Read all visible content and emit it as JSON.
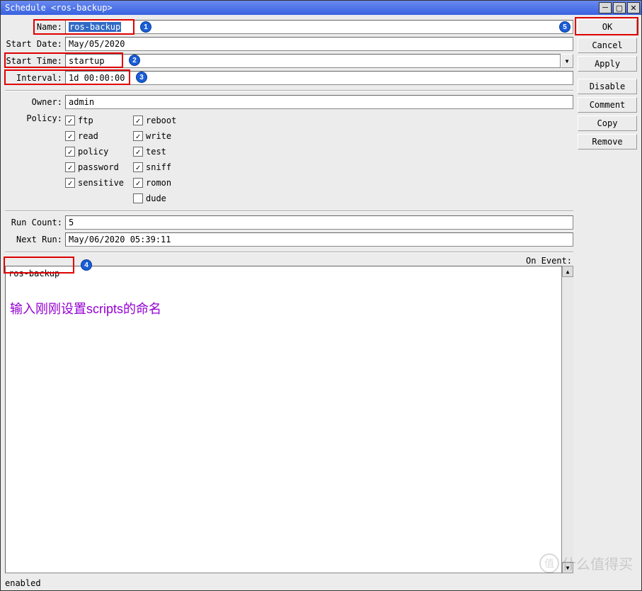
{
  "window": {
    "title": "Schedule <ros-backup>"
  },
  "form": {
    "name_label": "Name:",
    "name_value": "ros-backup",
    "start_date_label": "Start Date:",
    "start_date_value": "May/05/2020",
    "start_time_label": "Start Time:",
    "start_time_value": "startup",
    "interval_label": "Interval:",
    "interval_value": "1d 00:00:00",
    "owner_label": "Owner:",
    "owner_value": "admin",
    "policy_label": "Policy:",
    "policies": {
      "ftp": {
        "label": "ftp",
        "checked": true
      },
      "read": {
        "label": "read",
        "checked": true
      },
      "policy": {
        "label": "policy",
        "checked": true
      },
      "password": {
        "label": "password",
        "checked": true
      },
      "sensitive": {
        "label": "sensitive",
        "checked": true
      },
      "reboot": {
        "label": "reboot",
        "checked": true
      },
      "write": {
        "label": "write",
        "checked": true
      },
      "test": {
        "label": "test",
        "checked": true
      },
      "sniff": {
        "label": "sniff",
        "checked": true
      },
      "romon": {
        "label": "romon",
        "checked": true
      },
      "dude": {
        "label": "dude",
        "checked": false
      }
    },
    "run_count_label": "Run Count:",
    "run_count_value": "5",
    "next_run_label": "Next Run:",
    "next_run_value": "May/06/2020 05:39:11",
    "on_event_label": "On Event:",
    "on_event_value": "ros-backup"
  },
  "buttons": {
    "ok": "OK",
    "cancel": "Cancel",
    "apply": "Apply",
    "disable": "Disable",
    "comment": "Comment",
    "copy": "Copy",
    "remove": "Remove"
  },
  "status": "enabled",
  "annotations": {
    "text": "输入刚刚设置scripts的命名",
    "n1": "1",
    "n2": "2",
    "n3": "3",
    "n4": "4",
    "n5": "5"
  },
  "watermark": "什么值得买",
  "watermark_badge": "值"
}
